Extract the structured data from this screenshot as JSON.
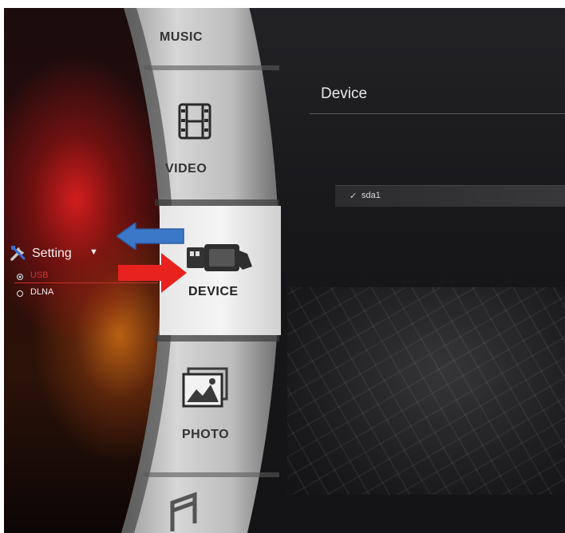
{
  "menu": {
    "items": [
      {
        "label": "MUSIC",
        "icon": "music-note-icon"
      },
      {
        "label": "VIDEO",
        "icon": "film-icon"
      },
      {
        "label": "DEVICE",
        "icon": "usb-plug-icon",
        "selected": true
      },
      {
        "label": "PHOTO",
        "icon": "photo-icon"
      },
      {
        "label": "",
        "icon": "music-note-icon"
      }
    ]
  },
  "content": {
    "title": "Device",
    "devices": [
      {
        "check": "✓",
        "name": "sda1"
      }
    ]
  },
  "setting": {
    "label": "Setting",
    "caret": "▼",
    "icon": "tools-icon",
    "options": [
      {
        "label": "USB",
        "selected": true
      },
      {
        "label": "DLNA",
        "selected": false
      }
    ]
  },
  "annotations": {
    "blue_arrow": {
      "direction": "left",
      "color": "#3c78c8"
    },
    "red_arrow": {
      "direction": "right",
      "color": "#e8221f"
    }
  },
  "colors": {
    "accent_red": "#d6322c",
    "menu_silver": "#c8c8c8",
    "selected_item": "#e9e9e9"
  }
}
